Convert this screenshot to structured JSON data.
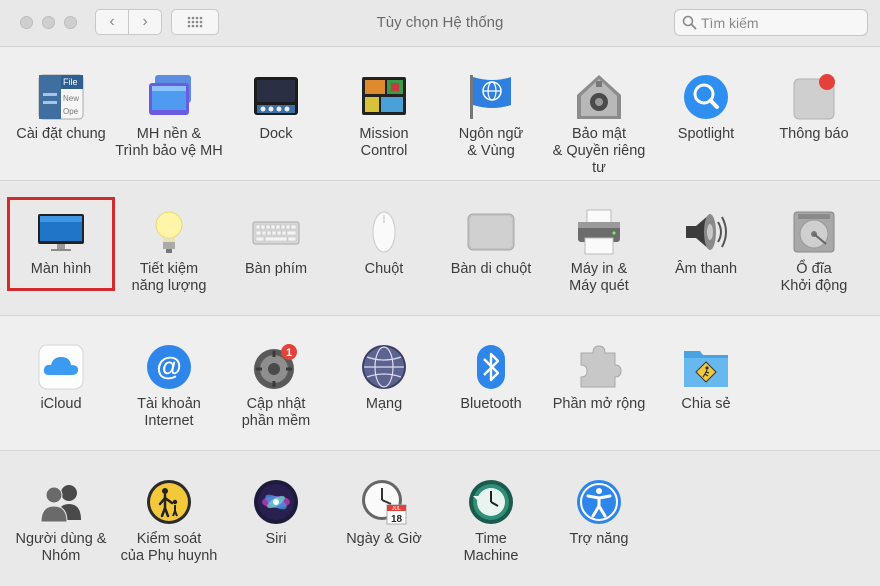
{
  "window": {
    "title": "Tùy chọn Hệ thống",
    "back_glyph": "‹",
    "forward_glyph": "›",
    "search_placeholder": "Tìm kiếm"
  },
  "rows": [
    [
      {
        "label": "Cài đặt chung",
        "icon": "general-icon"
      },
      {
        "label": "MH nền &\nTrình bảo vệ MH",
        "icon": "desktop-screensaver-icon"
      },
      {
        "label": "Dock",
        "icon": "dock-icon"
      },
      {
        "label": "Mission\nControl",
        "icon": "mission-control-icon"
      },
      {
        "label": "Ngôn ngữ\n& Vùng",
        "icon": "language-region-icon"
      },
      {
        "label": "Bảo mật\n& Quyền riêng tư",
        "icon": "security-privacy-icon"
      },
      {
        "label": "Spotlight",
        "icon": "spotlight-icon"
      },
      {
        "label": "Thông báo",
        "icon": "notifications-icon"
      }
    ],
    [
      {
        "label": "Màn hình",
        "icon": "display-icon"
      },
      {
        "label": "Tiết kiệm\nnăng lượng",
        "icon": "energy-saver-icon"
      },
      {
        "label": "Bàn phím",
        "icon": "keyboard-icon"
      },
      {
        "label": "Chuột",
        "icon": "mouse-icon"
      },
      {
        "label": "Bàn di chuột",
        "icon": "trackpad-icon"
      },
      {
        "label": "Máy in &\nMáy quét",
        "icon": "printer-icon"
      },
      {
        "label": "Âm thanh",
        "icon": "sound-icon"
      },
      {
        "label": "Ổ đĩa\nKhởi động",
        "icon": "startup-disk-icon"
      }
    ],
    [
      {
        "label": "iCloud",
        "icon": "icloud-icon"
      },
      {
        "label": "Tài khoản\nInternet",
        "icon": "internet-accounts-icon"
      },
      {
        "label": "Cập nhật\nphần mềm",
        "icon": "software-update-icon",
        "badge": "1"
      },
      {
        "label": "Mạng",
        "icon": "network-icon"
      },
      {
        "label": "Bluetooth",
        "icon": "bluetooth-icon"
      },
      {
        "label": "Phần mở rộng",
        "icon": "extensions-icon"
      },
      {
        "label": "Chia sẻ",
        "icon": "sharing-icon"
      }
    ],
    [
      {
        "label": "Người dùng &\nNhóm",
        "icon": "users-groups-icon"
      },
      {
        "label": "Kiểm soát\ncủa Phụ huynh",
        "icon": "parental-controls-icon"
      },
      {
        "label": "Siri",
        "icon": "siri-icon"
      },
      {
        "label": "Ngày & Giờ",
        "icon": "date-time-icon",
        "calendar_month": "JUL",
        "calendar_day": "18"
      },
      {
        "label": "Time\nMachine",
        "icon": "time-machine-icon"
      },
      {
        "label": "Trợ năng",
        "icon": "accessibility-icon"
      }
    ]
  ],
  "highlighted_item": "Màn hình",
  "colors": {
    "highlight_border": "#d32b2b",
    "badge_red": "#e5413a",
    "accent_blue": "#2f8ff0"
  }
}
